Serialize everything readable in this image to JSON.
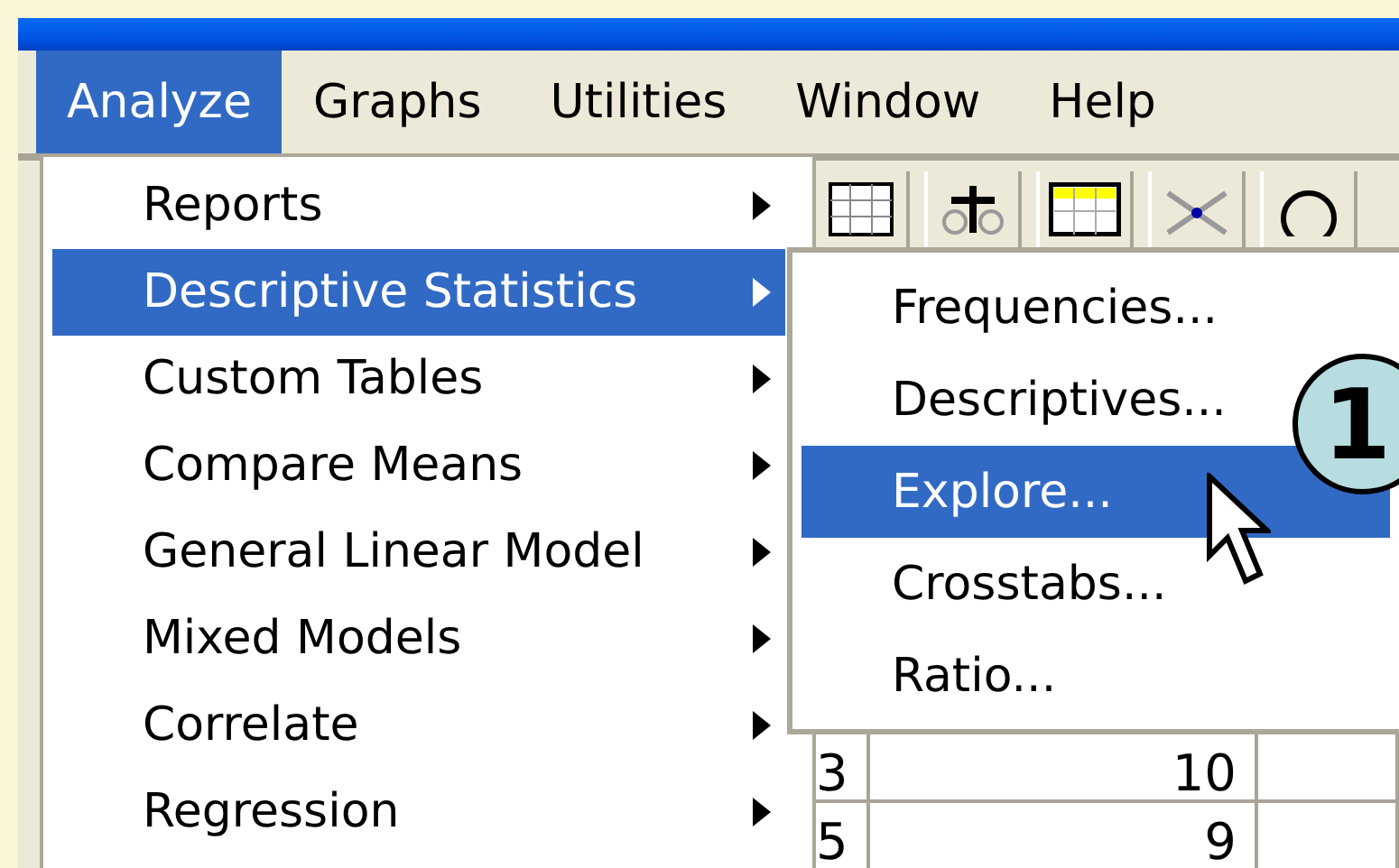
{
  "menubar": [
    {
      "label": "Analyze",
      "selected": true
    },
    {
      "label": "Graphs",
      "selected": false
    },
    {
      "label": "Utilities",
      "selected": false
    },
    {
      "label": "Window",
      "selected": false
    },
    {
      "label": "Help",
      "selected": false
    }
  ],
  "menu": [
    {
      "label": "Reports",
      "selected": false,
      "submenu": true
    },
    {
      "label": "Descriptive Statistics",
      "selected": true,
      "submenu": true
    },
    {
      "label": "Custom Tables",
      "selected": false,
      "submenu": true
    },
    {
      "label": "Compare Means",
      "selected": false,
      "submenu": true
    },
    {
      "label": "General Linear Model",
      "selected": false,
      "submenu": true
    },
    {
      "label": "Mixed Models",
      "selected": false,
      "submenu": true
    },
    {
      "label": "Correlate",
      "selected": false,
      "submenu": true
    },
    {
      "label": "Regression",
      "selected": false,
      "submenu": true
    }
  ],
  "submenu": [
    {
      "label": "Frequencies...",
      "selected": false
    },
    {
      "label": "Descriptives...",
      "selected": false
    },
    {
      "label": "Explore...",
      "selected": true
    },
    {
      "label": "Crosstabs...",
      "selected": false
    },
    {
      "label": "Ratio...",
      "selected": false
    }
  ],
  "grid_rows": [
    {
      "cells": [
        "3",
        "10"
      ]
    },
    {
      "cells": [
        "5",
        "9"
      ]
    }
  ],
  "step_badge": "1"
}
